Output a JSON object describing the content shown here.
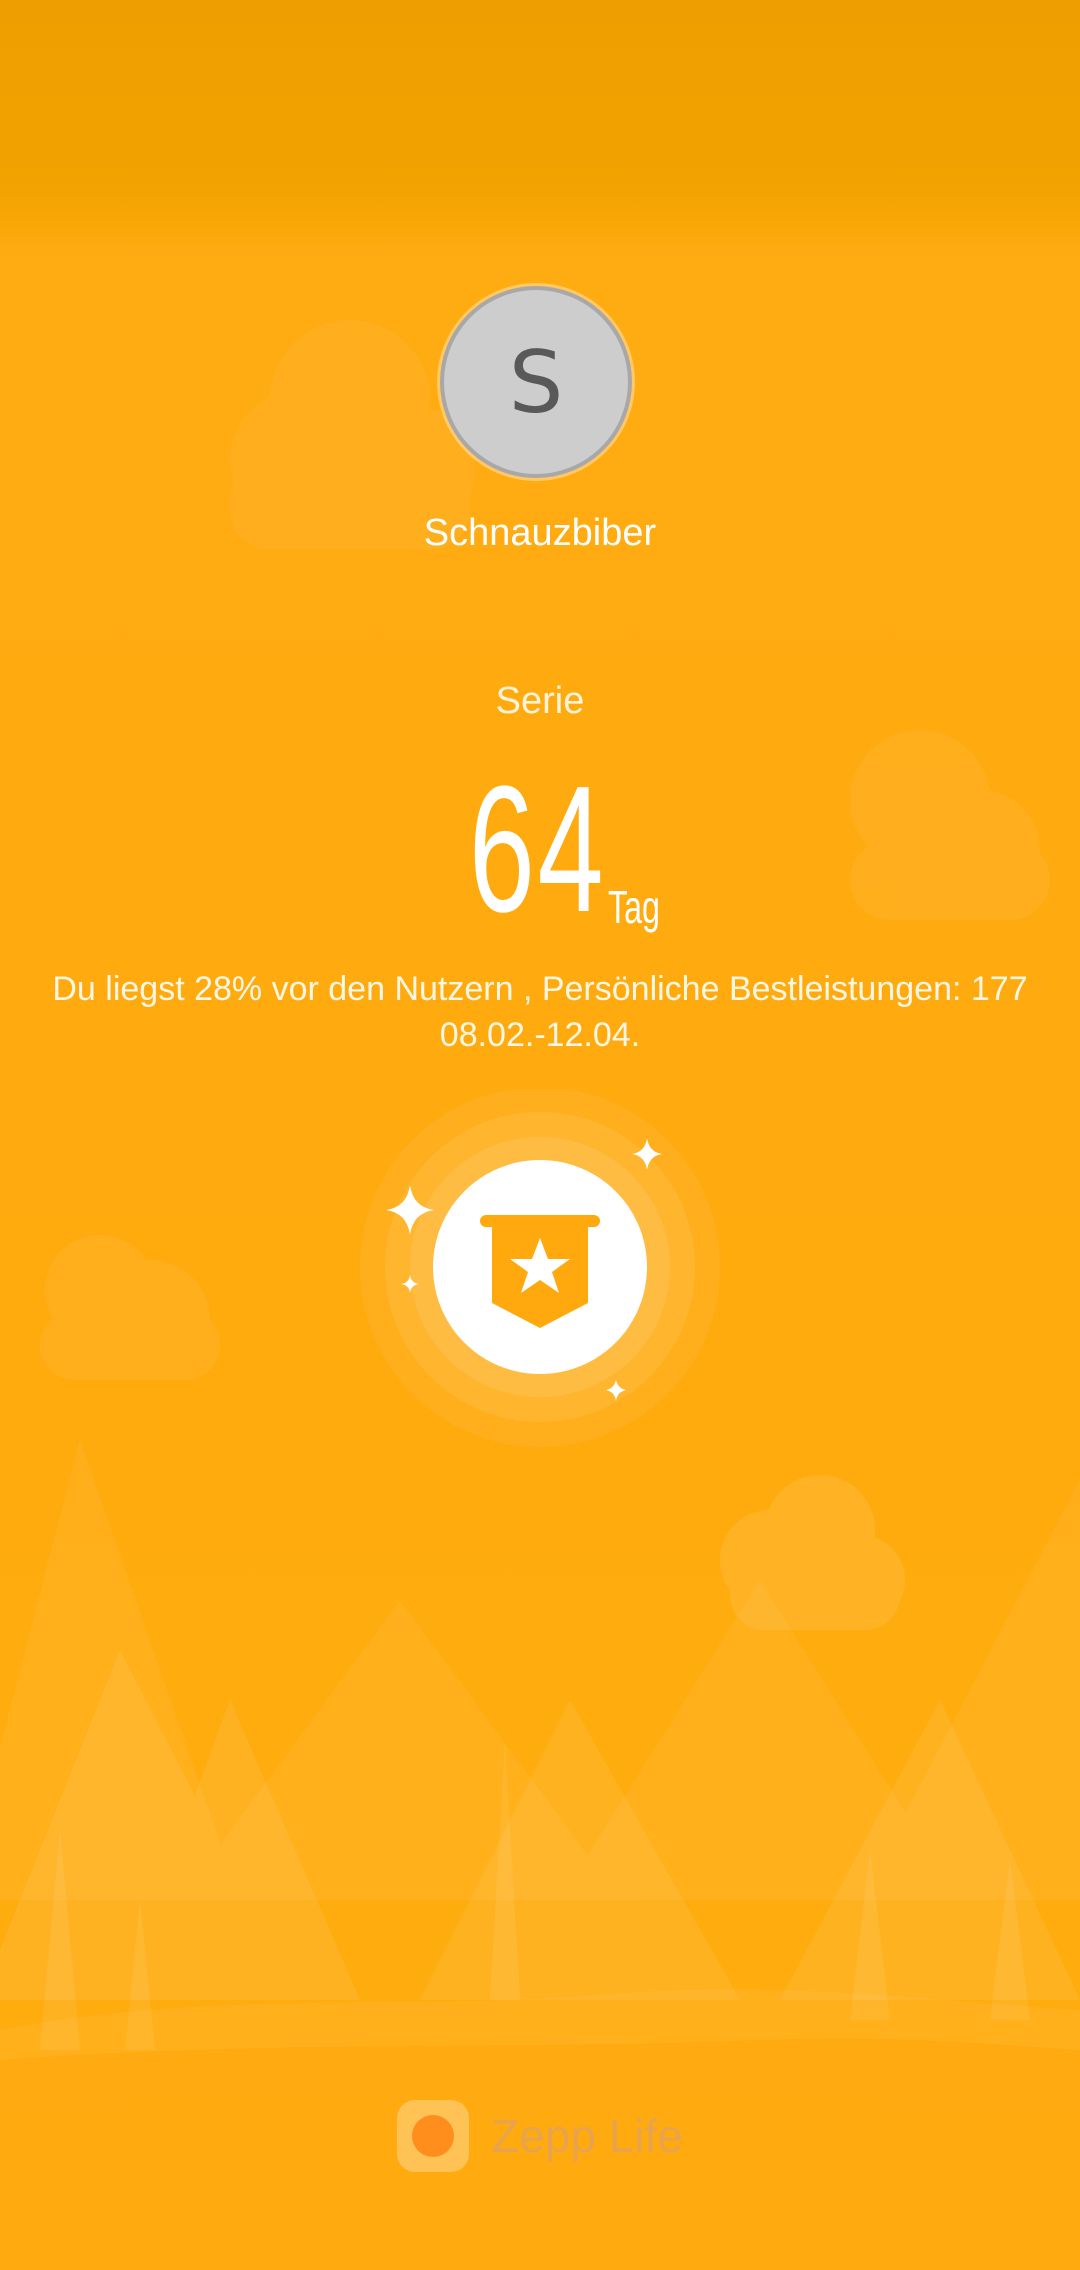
{
  "profile": {
    "avatar_letter": "S",
    "username": "Schnauzbiber"
  },
  "streak": {
    "label": "Serie",
    "value": "64",
    "unit": "Tag"
  },
  "info": {
    "line1": "Du liegst 28% vor den Nutzern , Persönliche Bestleistungen: 177",
    "line2": "08.02.-12.04."
  },
  "badge": {
    "icon": "achievement-banner-star-icon"
  },
  "footer": {
    "logo_icon": "zepp-life-logo-icon",
    "app_name": "Zepp Life"
  },
  "colors": {
    "background": "#FFAB0E",
    "top_band": "#F3A100",
    "text_primary": "#FFFFFF",
    "badge_circle": "#FFFFFF",
    "badge_icon": "#FFA90F"
  }
}
